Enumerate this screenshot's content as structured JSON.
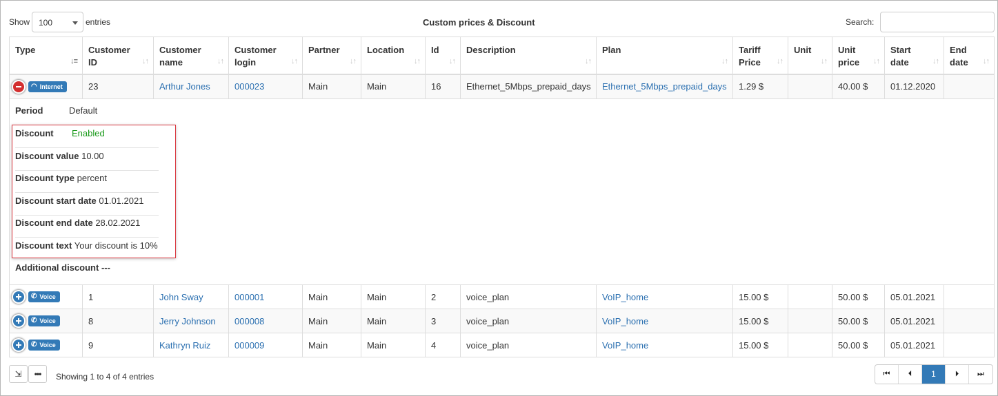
{
  "toolbar": {
    "show_label": "Show",
    "page_length": "100",
    "entries_label": "entries",
    "title": "Custom prices & Discount",
    "search_label": "Search:",
    "search_value": ""
  },
  "columns": [
    {
      "line1": "Type",
      "line2": ""
    },
    {
      "line1": "Customer",
      "line2": "ID"
    },
    {
      "line1": "Customer",
      "line2": "name"
    },
    {
      "line1": "Customer",
      "line2": "login"
    },
    {
      "line1": "Partner",
      "line2": ""
    },
    {
      "line1": "Location",
      "line2": ""
    },
    {
      "line1": "Id",
      "line2": ""
    },
    {
      "line1": "Description",
      "line2": ""
    },
    {
      "line1": "Plan",
      "line2": ""
    },
    {
      "line1": "Tariff",
      "line2": "Price"
    },
    {
      "line1": "Unit",
      "line2": ""
    },
    {
      "line1": "Unit",
      "line2": "price"
    },
    {
      "line1": "Start",
      "line2": "date"
    },
    {
      "line1": "End",
      "line2": "date"
    }
  ],
  "sort_icon": "sort-icon",
  "rows": [
    {
      "type": "Internet",
      "type_icon": "wifi-icon",
      "customer_id": "23",
      "customer_name": "Arthur Jones",
      "customer_login": "000023",
      "partner": "Main",
      "location": "Main",
      "id": "16",
      "description": "Ethernet_5Mbps_prepaid_days",
      "plan": "Ethernet_5Mbps_prepaid_days",
      "tariff_price": "1.29 $",
      "unit": "",
      "unit_price": "40.00 $",
      "start_date": "01.12.2020",
      "end_date": ""
    },
    {
      "type": "Voice",
      "type_icon": "phone-icon",
      "customer_id": "1",
      "customer_name": "John Sway",
      "customer_login": "000001",
      "partner": "Main",
      "location": "Main",
      "id": "2",
      "description": "voice_plan",
      "plan": "VoIP_home",
      "tariff_price": "15.00 $",
      "unit": "",
      "unit_price": "50.00 $",
      "start_date": "05.01.2021",
      "end_date": ""
    },
    {
      "type": "Voice",
      "type_icon": "phone-icon",
      "customer_id": "8",
      "customer_name": "Jerry Johnson",
      "customer_login": "000008",
      "partner": "Main",
      "location": "Main",
      "id": "3",
      "description": "voice_plan",
      "plan": "VoIP_home",
      "tariff_price": "15.00 $",
      "unit": "",
      "unit_price": "50.00 $",
      "start_date": "05.01.2021",
      "end_date": ""
    },
    {
      "type": "Voice",
      "type_icon": "phone-icon",
      "customer_id": "9",
      "customer_name": "Kathryn Ruiz",
      "customer_login": "000009",
      "partner": "Main",
      "location": "Main",
      "id": "4",
      "description": "voice_plan",
      "plan": "VoIP_home",
      "tariff_price": "15.00 $",
      "unit": "",
      "unit_price": "50.00 $",
      "start_date": "05.01.2021",
      "end_date": ""
    }
  ],
  "details": {
    "period_label": "Period",
    "period_value": "Default",
    "discount_label": "Discount",
    "discount_value": "Enabled",
    "items": [
      {
        "label": "Discount value",
        "value": "10.00"
      },
      {
        "label": "Discount type",
        "value": "percent"
      },
      {
        "label": "Discount start date",
        "value": "01.01.2021"
      },
      {
        "label": "Discount end date",
        "value": "28.02.2021"
      },
      {
        "label": "Discount text",
        "value": "Your discount is 10%"
      }
    ],
    "additional_label": "Additional discount",
    "additional_value": "---"
  },
  "footer": {
    "export_icon": "export-icon",
    "more_icon": "more-icon",
    "info": "Showing 1 to 4 of 4 entries",
    "current_page": "1"
  },
  "colors": {
    "accent": "#337ab7",
    "link": "#2a6fb0",
    "enabled": "#1a9a1a",
    "highlight_border": "#d9363e"
  }
}
